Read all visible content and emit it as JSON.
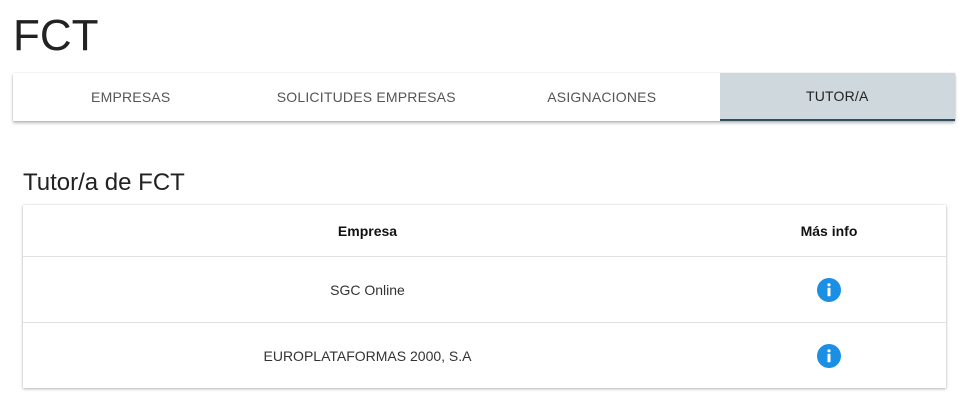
{
  "app": {
    "title": "FCT"
  },
  "tabs": [
    {
      "label": "EMPRESAS",
      "active": false
    },
    {
      "label": "SOLICITUDES EMPRESAS",
      "active": false
    },
    {
      "label": "ASIGNACIONES",
      "active": false
    },
    {
      "label": "TUTOR/A",
      "active": true
    }
  ],
  "section": {
    "title": "Tutor/a de FCT"
  },
  "table": {
    "headers": [
      "Empresa",
      "Más info"
    ],
    "rows": [
      {
        "empresa": "SGC Online",
        "info_icon": "info-icon"
      },
      {
        "empresa": "EUROPLATAFORMAS 2000, S.A",
        "info_icon": "info-icon"
      }
    ]
  },
  "colors": {
    "active_tab_bg": "#cfd8dc",
    "active_tab_indicator": "#2f4f5f",
    "info_icon": "#1a8fe3"
  }
}
